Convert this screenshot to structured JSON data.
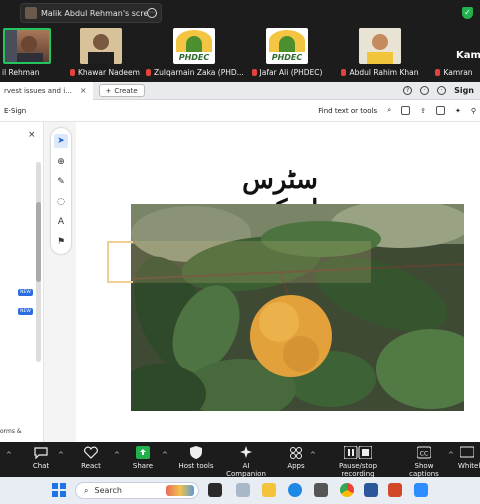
{
  "zoom_top": {
    "share_label": "Malik Abdul Rehman's screen",
    "participants": [
      {
        "name": "il Rehman",
        "active": true
      },
      {
        "name": "Khawar Nadeem"
      },
      {
        "name": "Zulqarnain Zaka (PHD..."
      },
      {
        "name": "Jafar Ali (PHDEC)"
      },
      {
        "name": "Abdul Rahim Khan"
      },
      {
        "name": "Kamran"
      }
    ],
    "logo_text": "PHDEC",
    "overflow_name": "Kamr"
  },
  "browser": {
    "tab_title": "rvest issues and i...",
    "create_label": "Create",
    "sign_label": "Sign",
    "toolbar_left": "E-Sign",
    "find_label": "Find text or tools"
  },
  "left_panel": {
    "badges": [
      "NEW",
      "NEW"
    ],
    "bottom_text": "orms &"
  },
  "document": {
    "title": "سٹرس اسکیپ"
  },
  "zoom_bottom": {
    "items": [
      "Chat",
      "React",
      "Share",
      "Host tools",
      "AI Companion",
      "Apps",
      "Pause/stop recording",
      "Show captions",
      "Whitel"
    ]
  },
  "taskbar": {
    "search_placeholder": "Search"
  },
  "colors": {
    "zoom_bg": "#1c1c1c",
    "share_green": "#23b14d",
    "adobe_blue": "#1f5fd6",
    "mute_red": "#e2433c"
  }
}
